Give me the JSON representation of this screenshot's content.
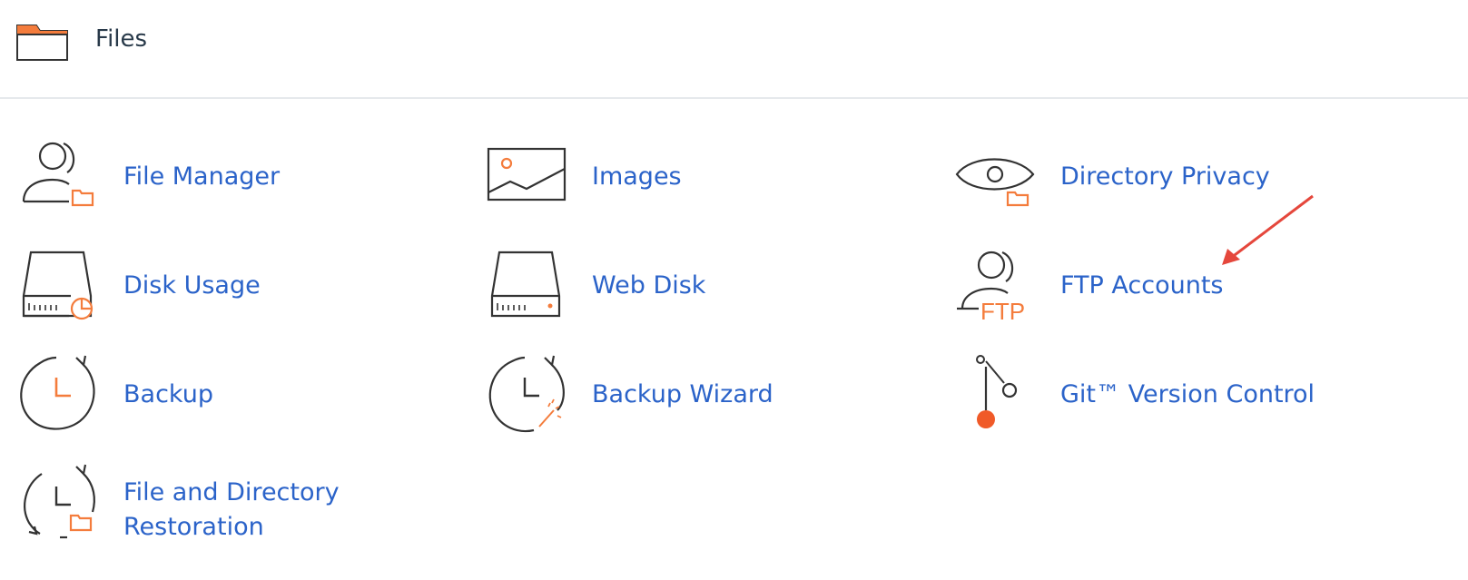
{
  "section": {
    "title": "Files",
    "icon": "folder-icon"
  },
  "items": [
    {
      "label": "File Manager",
      "icon": "file-manager-icon"
    },
    {
      "label": "Images",
      "icon": "images-icon"
    },
    {
      "label": "Directory Privacy",
      "icon": "directory-privacy-icon"
    },
    {
      "label": "Disk Usage",
      "icon": "disk-usage-icon"
    },
    {
      "label": "Web Disk",
      "icon": "web-disk-icon"
    },
    {
      "label": "FTP Accounts",
      "icon": "ftp-accounts-icon"
    },
    {
      "label": "Backup",
      "icon": "backup-icon"
    },
    {
      "label": "Backup Wizard",
      "icon": "backup-wizard-icon"
    },
    {
      "label": "Git™ Version Control",
      "icon": "git-version-control-icon"
    },
    {
      "label": "File and Directory Restoration",
      "icon": "file-directory-restoration-icon"
    }
  ],
  "ftp_icon_text": "FTP",
  "colors": {
    "link": "#2b63c9",
    "accent_orange": "#f47c3c",
    "icon_stroke": "#333333",
    "annotation_arrow": "#e5473c",
    "divider": "#e6e9ec"
  }
}
